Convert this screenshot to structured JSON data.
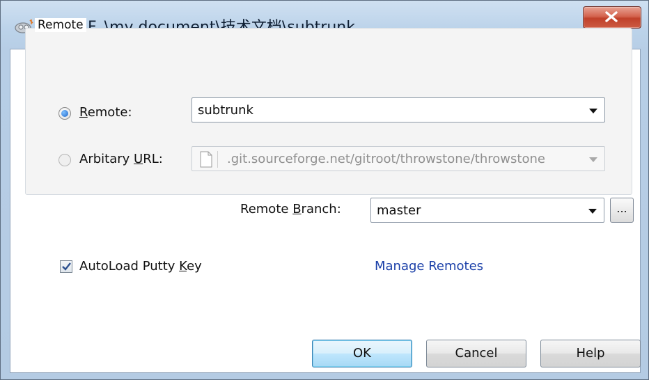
{
  "window": {
    "title": "Pull - F_\\my document\\技术文档\\subtrunk",
    "app_icon": "git-pull-icon",
    "close_icon": "close-icon"
  },
  "group": {
    "label": "Remote"
  },
  "remote": {
    "radio_label_prefix": "",
    "radio_label_accel": "R",
    "radio_label_rest": "emote:",
    "selected": true,
    "value": "subtrunk"
  },
  "url": {
    "radio_label_prefix": "Arbitary ",
    "radio_label_accel": "U",
    "radio_label_rest": "RL:",
    "selected": false,
    "value": ".git.sourceforge.net/gitroot/throwstone/throwstone"
  },
  "branch": {
    "label_prefix": "Remote ",
    "label_accel": "B",
    "label_rest": "ranch:",
    "value": "master",
    "browse_label": "..."
  },
  "autoload": {
    "label_prefix": "AutoLoad Putty ",
    "label_accel": "K",
    "label_rest": "ey",
    "checked": true
  },
  "manage_remotes": "Manage Remotes",
  "buttons": {
    "ok": "OK",
    "cancel": "Cancel",
    "help": "Help"
  },
  "colors": {
    "link": "#1a3fa8",
    "ok_border": "#3c7fb1",
    "close_red": "#c0412a"
  }
}
